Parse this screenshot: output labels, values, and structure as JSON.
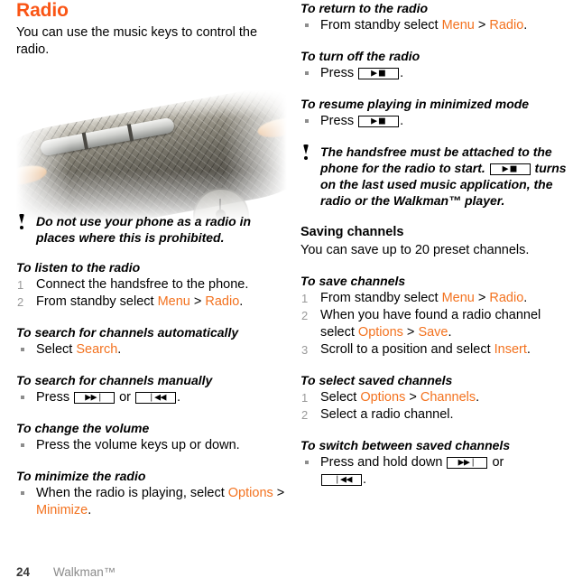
{
  "chapter": {
    "title": "Radio",
    "intro": "You can use the music keys to control the radio."
  },
  "photo": {
    "alt": "Phone side view showing music control keys"
  },
  "icons": {
    "note_icon": "exclamation-icon",
    "key_next": "next-track-key-icon",
    "key_prev": "previous-track-key-icon",
    "key_play_stop": "play-stop-key-icon",
    "glyph_next": "▶▶❘",
    "glyph_prev": "❘◀◀",
    "glyph_play_stop": "▶■"
  },
  "colors": {
    "title_orange": "#FA5515",
    "accent_orange": "#F3721F",
    "list_marker_gray": "#9a9a9a",
    "footer_gray": "#8b8b8b"
  },
  "left_column": {
    "note_1": {
      "text": "Do not use your phone as a radio in places where this is prohibited."
    },
    "section_listen": {
      "heading": "To listen to the radio",
      "steps": [
        {
          "num": "1",
          "pre": "Connect the handsfree to the phone.",
          "a1": "",
          "mid": "",
          "a2": "",
          "post": ""
        },
        {
          "num": "2",
          "pre": "From standby select ",
          "a1": "Menu",
          "mid": " > ",
          "a2": "Radio",
          "post": "."
        }
      ]
    },
    "section_search_auto": {
      "heading": "To search for channels automatically",
      "bullet_pre": "Select ",
      "bullet_a1": "Search",
      "bullet_post": "."
    },
    "section_search_manual": {
      "heading": "To search for channels manually",
      "bullet_pre": "Press ",
      "bullet_mid": " or ",
      "bullet_post": "."
    },
    "section_volume": {
      "heading": "To change the volume",
      "bullet": "Press the volume keys up or down."
    },
    "section_minimize": {
      "heading": "To minimize the radio",
      "bullet_pre": "When the radio is playing, select ",
      "bullet_a1": "Options",
      "bullet_mid": " > ",
      "bullet_a2": "Minimize",
      "bullet_post": "."
    }
  },
  "right_column": {
    "section_return": {
      "heading": "To return to the radio",
      "bullet_pre": "From standby select ",
      "bullet_a1": "Menu",
      "bullet_mid": " > ",
      "bullet_a2": "Radio",
      "bullet_post": "."
    },
    "section_turn_off": {
      "heading": "To turn off the radio",
      "bullet_pre": "Press ",
      "bullet_post": "."
    },
    "section_resume": {
      "heading": "To resume playing in minimized mode",
      "bullet_pre": "Press ",
      "bullet_post": "."
    },
    "note_2": {
      "part1": "The handsfree must be attached to the phone for the radio to start. ",
      "part2": " turns on the last used music application, the radio or the Walkman™ player."
    },
    "section_saving": {
      "heading": "Saving channels",
      "text": "You can save up to 20 preset channels."
    },
    "section_save_channels": {
      "heading": "To save channels",
      "steps": [
        {
          "num": "1",
          "pre": "From standby select ",
          "a1": "Menu",
          "mid": " > ",
          "a2": "Radio",
          "post": "."
        },
        {
          "num": "2",
          "pre": "When you have found a radio channel select ",
          "a1": "Options",
          "mid": " > ",
          "a2": "Save",
          "post": "."
        },
        {
          "num": "3",
          "pre": "Scroll to a position and select ",
          "a1": "Insert",
          "mid": "",
          "a2": "",
          "post": "."
        }
      ]
    },
    "section_select_saved": {
      "heading": "To select saved channels",
      "steps": [
        {
          "num": "1",
          "pre": "Select ",
          "a1": "Options",
          "mid": " > ",
          "a2": "Channels",
          "post": "."
        },
        {
          "num": "2",
          "pre": "Select a radio channel.",
          "a1": "",
          "mid": "",
          "a2": "",
          "post": ""
        }
      ]
    },
    "section_switch": {
      "heading": "To switch between saved channels",
      "bullet_pre": "Press and hold down ",
      "bullet_mid": " or ",
      "bullet_post": "."
    }
  },
  "footer": {
    "page_number": "24",
    "section": "Walkman™"
  }
}
